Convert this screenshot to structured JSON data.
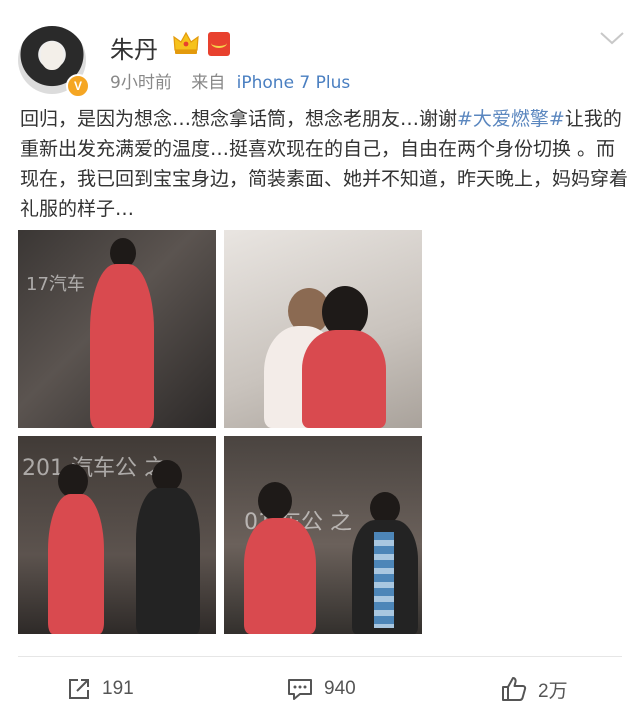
{
  "user": {
    "name": "朱丹",
    "verified_badge": "V",
    "icons": [
      "crown-icon",
      "red-packet-icon"
    ]
  },
  "meta": {
    "time": "9小时前",
    "source_prefix": "来自",
    "device": "iPhone 7 Plus"
  },
  "post": {
    "text_before": "回归，是因为想念…想念拿话筒，想念老朋友…谢谢",
    "topic": "#大爱燃擎#",
    "text_after": "让我的重新出发充满爱的温度…挺喜欢现在的自己，自由在两个身份切换 。而现在，我已回到宝宝身边，简装素面、她并不知道，昨天晚上，妈妈穿着礼服的样子…"
  },
  "photos": {
    "p1_text": "17汽车",
    "p3_text": "201  汽车公  之",
    "p4_text": "01  车公  之"
  },
  "actions": {
    "share_count": "191",
    "comment_count": "940",
    "like_count": "2万"
  },
  "colors": {
    "topic_link": "#5b87bf",
    "device_link": "#4a7fc1",
    "badge": "#f5a623",
    "red_packet": "#e8412e"
  }
}
